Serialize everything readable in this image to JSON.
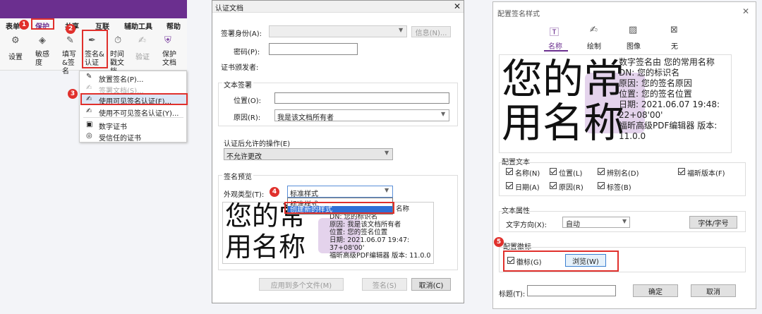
{
  "ribbon": {
    "tabs": [
      "表单",
      "保护",
      "共享",
      "互联",
      "辅助工具",
      "帮助"
    ],
    "buttons": [
      "设置",
      "敏感度",
      "填写&签名",
      "签名&认证",
      "时间戳文档",
      "验证",
      "保护文档"
    ],
    "menu": [
      "放置签名(P)...",
      "签署文档(S)...",
      "使用可见签名认证(F)...",
      "使用不可见签名认证(Y)...",
      "数字证书",
      "受信任的证书"
    ]
  },
  "cert": {
    "title": "认证文档",
    "identity_label": "签署身份(A):",
    "info_btn": "信息(N)...",
    "pwd_label": "密码(P):",
    "issuer_label": "证书颁发者:",
    "text_section": "文本签署",
    "loc_label": "位置(O):",
    "reason_label": "原因(R):",
    "reason_value": "我是该文档所有者",
    "allowed_label": "认证后允许的操作(E)",
    "allowed_value": "不允许更改",
    "preview_section": "签名预览",
    "appearance_label": "外观类型(T):",
    "appearance_value": "标准样式",
    "options": [
      "标准样式",
      "创建新的样式"
    ],
    "preview_big": [
      "您的常",
      "用名称"
    ],
    "preview_lines": [
      "名称",
      "DN:  您的标识名",
      "原因:  我是该文档所有者",
      "位置:  您的签名位置",
      "日期:  2021.06.07 19:47:",
      "37+08'00'",
      "福昕高级PDF编辑器 版本: 11.0.0"
    ],
    "apply_btn": "应用到多个文件(M)",
    "sign_btn": "签名(S)",
    "cancel_btn": "取消(C)"
  },
  "config": {
    "title": "配置签名样式",
    "tabs": [
      "名称",
      "绘制",
      "图像",
      "无"
    ],
    "preview_big": [
      "您的常",
      "用名称"
    ],
    "preview_lines": [
      "数字签名由 您的常用名称",
      "DN:  您的标识名",
      "原因:  您的签名原因",
      "位置:  您的签名位置",
      "日期:  2021.06.07 19:48:",
      "22+08'00'",
      "福昕高级PDF编辑器 版本:",
      "11.0.0"
    ],
    "text_section": "配置文本",
    "checks": [
      "名称(N)",
      "位置(L)",
      "辨别名(D)",
      "福昕版本(F)",
      "日期(A)",
      "原因(R)",
      "标签(B)"
    ],
    "prop_section": "文本属性",
    "dir_label": "文字方向(X):",
    "dir_value": "自动",
    "font_btn": "字体/字号",
    "logo_section": "配置徽标",
    "logo_check": "徽标(G)",
    "browse_btn": "浏览(W)",
    "title_label": "标题(T):",
    "ok_btn": "确定",
    "cancel_btn": "取消"
  },
  "steps": [
    "1",
    "2",
    "3",
    "4",
    "5"
  ]
}
